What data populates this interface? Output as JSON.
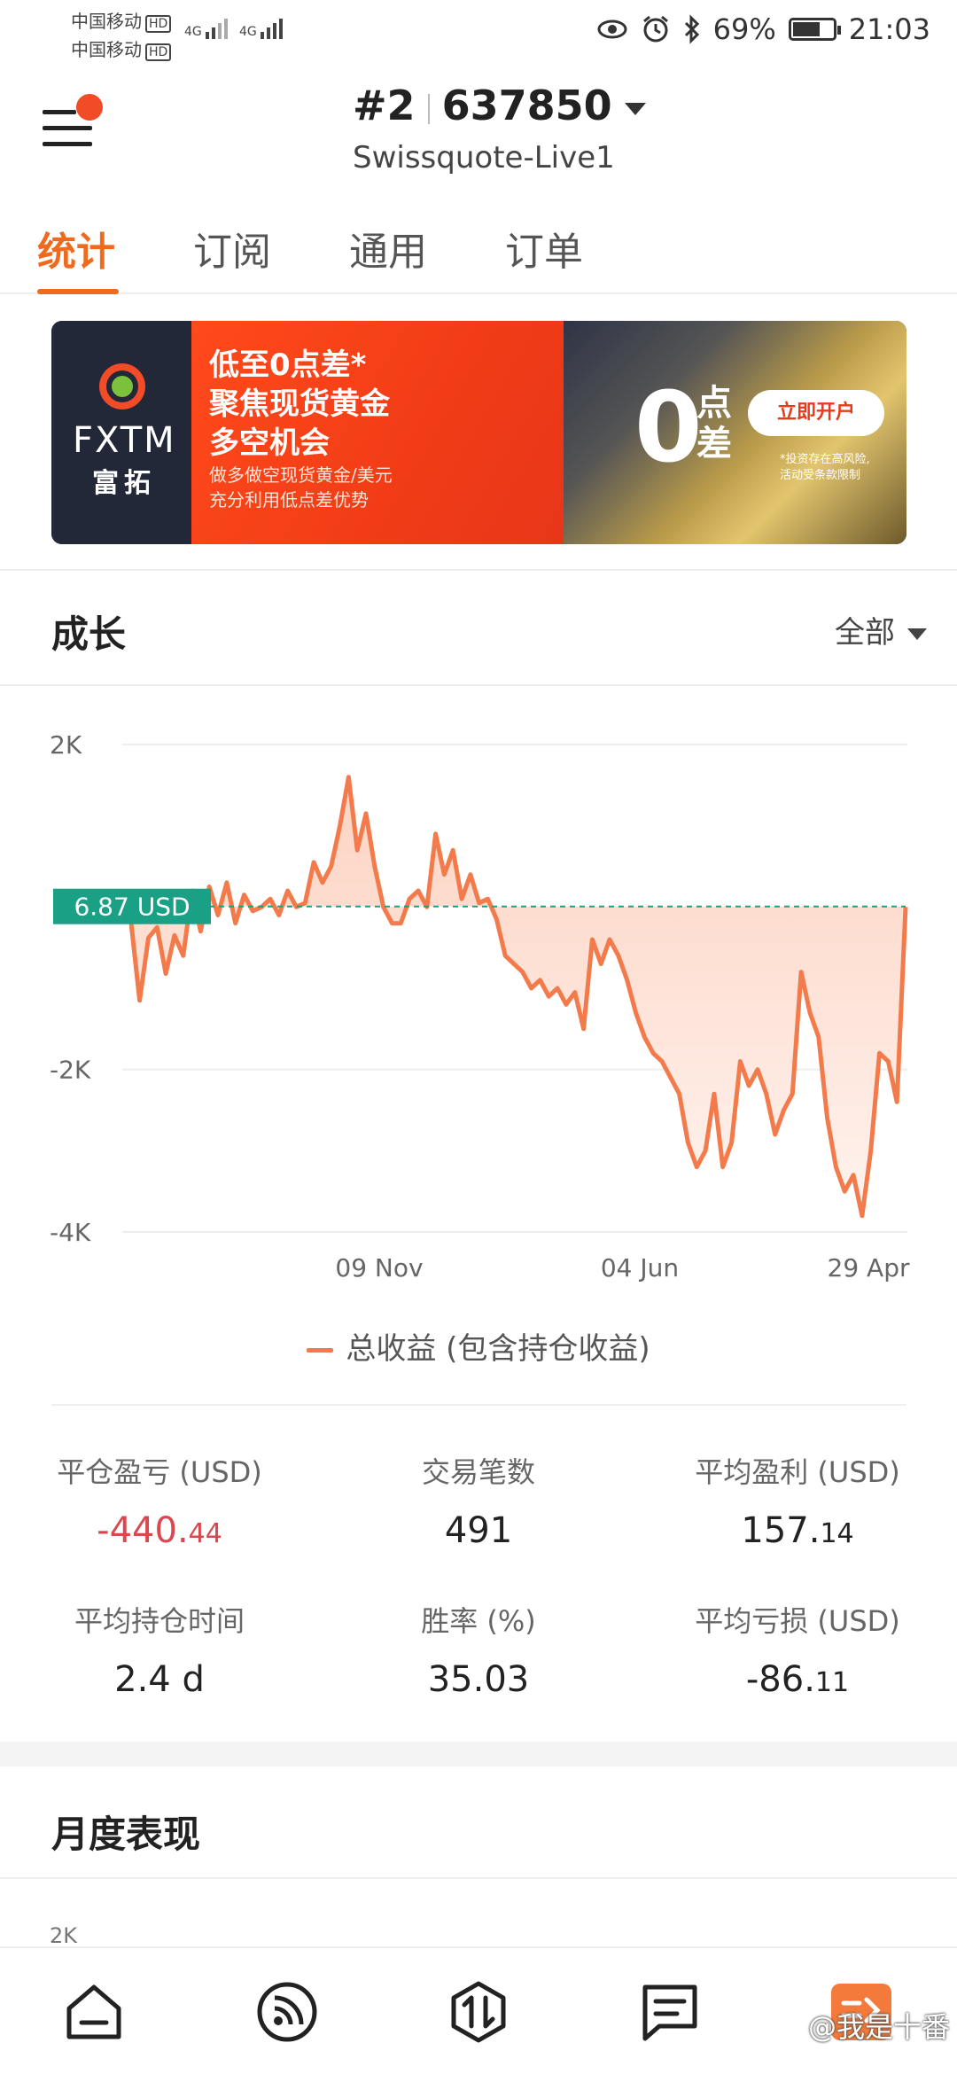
{
  "status_bar": {
    "carrier_1": "中国移动",
    "carrier_2": "中国移动",
    "hd_badge": "HD",
    "network_1": "4G",
    "network_2": "4G",
    "battery_percent": "69%",
    "battery_level": 0.69,
    "time": "21:03",
    "icons": [
      "eye-icon",
      "alarm-icon",
      "bluetooth-icon",
      "battery-icon"
    ]
  },
  "header": {
    "account_index": "#2",
    "account_number": "637850",
    "server": "Swissquote-Live1"
  },
  "tabs": [
    "统计",
    "订阅",
    "通用",
    "订单"
  ],
  "banner": {
    "brand": "FXTM",
    "brand_cn": "富拓",
    "headline_1": "低至0点差*",
    "headline_2": "聚焦现货黄金",
    "headline_3": "多空机会",
    "sub_1": "做多做空现货黄金/美元",
    "sub_2": "充分利用低点差优势",
    "zero": "0",
    "zero_suffix_1": "点",
    "zero_suffix_2": "差",
    "cta": "立即开户",
    "risk_1": "*投资存在高风险,",
    "risk_2": "活动受条款限制"
  },
  "growth": {
    "title": "成长",
    "filter": "全部",
    "current_value_label": "6.87 USD",
    "legend": "总收益 (包含持仓收益)"
  },
  "chart_data": {
    "type": "area",
    "y_ticks": [
      "2K",
      "-2K",
      "-4K"
    ],
    "x_ticks": [
      "09 Nov",
      "04 Jun",
      "29 Apr"
    ],
    "ylim": [
      -4000,
      2000
    ],
    "grid": true,
    "reference_line": 6.87,
    "series": [
      {
        "name": "总收益 (包含持仓收益)",
        "values": [
          0,
          -180,
          -1150,
          -380,
          -250,
          -820,
          -350,
          -600,
          200,
          -300,
          250,
          -100,
          300,
          -200,
          150,
          -50,
          0,
          100,
          -100,
          200,
          0,
          50,
          550,
          300,
          500,
          1000,
          1600,
          700,
          1150,
          500,
          0,
          -200,
          -200,
          100,
          200,
          0,
          900,
          400,
          700,
          100,
          400,
          50,
          100,
          -150,
          -600,
          -700,
          -800,
          -1000,
          -900,
          -1100,
          -1000,
          -1200,
          -1050,
          -1500,
          -400,
          -700,
          -400,
          -600,
          -900,
          -1300,
          -1600,
          -1800,
          -1900,
          -2100,
          -2300,
          -2900,
          -3200,
          -3000,
          -2300,
          -3200,
          -2900,
          -1900,
          -2200,
          -2000,
          -2300,
          -2800,
          -2500,
          -2300,
          -800,
          -1300,
          -1600,
          -2600,
          -3200,
          -3500,
          -3300,
          -3800,
          -3000,
          -1800,
          -1900,
          -2400,
          0
        ]
      }
    ]
  },
  "stats": [
    {
      "label": "平仓盈亏 (USD)",
      "int": "-440.",
      "dec": "44",
      "negative": true
    },
    {
      "label": "交易笔数",
      "int": "491",
      "dec": "",
      "negative": false
    },
    {
      "label": "平均盈利 (USD)",
      "int": "157.",
      "dec": "14",
      "negative": false
    },
    {
      "label": "平均持仓时间",
      "int": "2.4 d",
      "dec": "",
      "negative": false
    },
    {
      "label": "胜率 (%)",
      "int": "35.03",
      "dec": "",
      "negative": false
    },
    {
      "label": "平均亏损 (USD)",
      "int": "-86.",
      "dec": "11",
      "negative": false
    }
  ],
  "monthly": {
    "title": "月度表现",
    "axis_top": "2K"
  },
  "bottom_nav": {
    "items": [
      "home-icon",
      "signals-icon",
      "trade-icon",
      "news-icon",
      "profile-icon"
    ],
    "watermark": "@我是十番"
  },
  "colors": {
    "accent": "#f06a1e",
    "line": "#f37a4a",
    "area": "#fcd3c2",
    "reference": "#1aa085",
    "negative": "#d9474f"
  }
}
